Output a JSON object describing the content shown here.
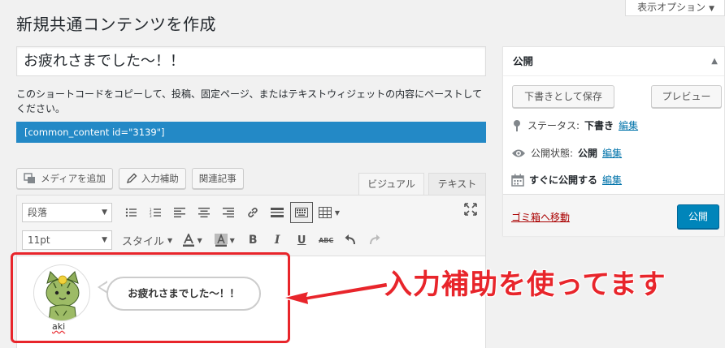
{
  "screen_options": {
    "label": "表示オプション"
  },
  "page": {
    "title": "新規共通コンテンツを作成"
  },
  "title_field": {
    "value": "お疲れさまでした～！！"
  },
  "instructions": "このショートコードをコピーして、投稿、固定ページ、またはテキストウィジェットの内容にペーストしてください。",
  "shortcode": "[common_content id=\"3139\"]",
  "media_buttons": {
    "add_media": "メディアを追加",
    "input_assist": "入力補助",
    "related_posts": "関連記事"
  },
  "editor_tabs": {
    "visual": "ビジュアル",
    "text": "テキスト"
  },
  "toolbar": {
    "format_select": "段落",
    "font_size_select": "11pt",
    "styles_label": "スタイル"
  },
  "content": {
    "avatar_name": "aki",
    "bubble_text": "お疲れさまでした～！！"
  },
  "annotation": "入力補助を使ってます",
  "publish": {
    "header": "公開",
    "save_draft": "下書きとして保存",
    "preview": "プレビュー",
    "status_label": "ステータス:",
    "status_value": "下書き",
    "visibility_label": "公開状態:",
    "visibility_value": "公開",
    "schedule_label": "すぐに公開する",
    "edit_link": "編集",
    "trash": "ゴミ箱へ移動",
    "publish_button": "公開"
  },
  "colors": {
    "accent_blue": "#2389c6",
    "primary_button": "#0085ba",
    "annotation_red": "#e8252b",
    "link": "#0073aa",
    "trash_link": "#a00"
  }
}
